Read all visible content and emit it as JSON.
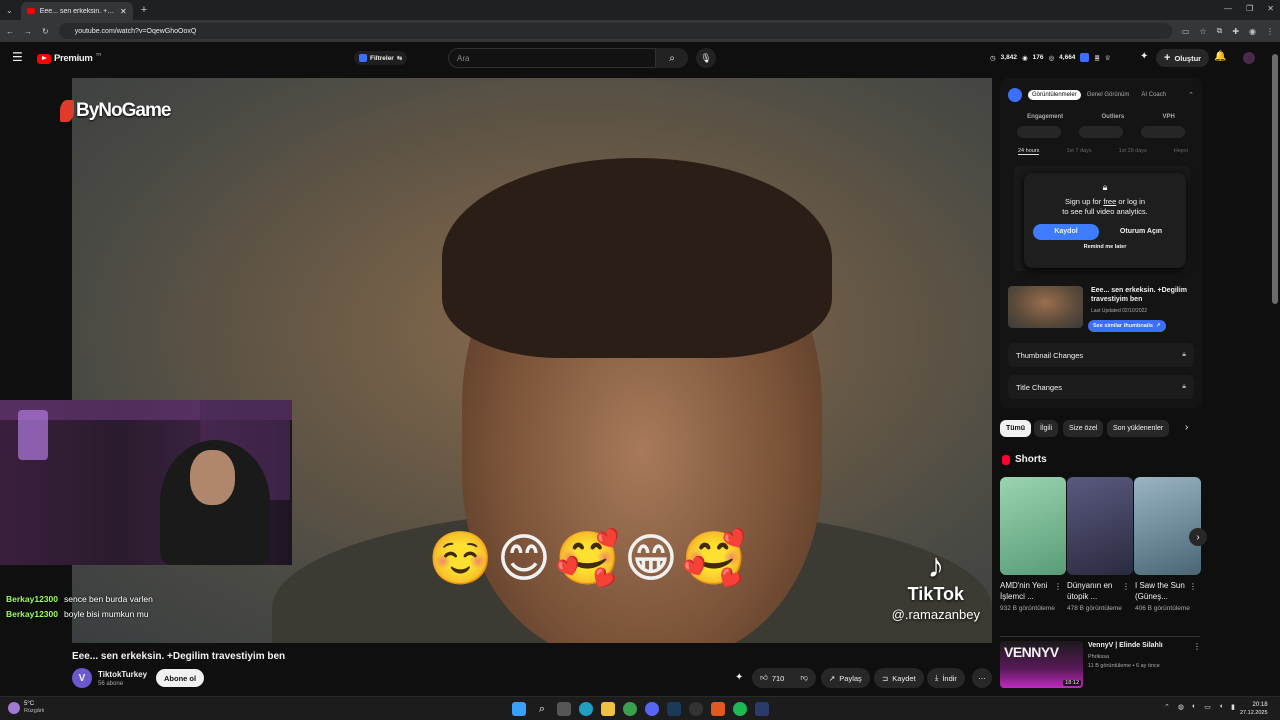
{
  "browser": {
    "tab_title": "Eee... sen erkeksin. +Degilim tr...",
    "url": "youtube.com/watch?v=OqewGhoOoxQ",
    "new_tab": "+"
  },
  "header": {
    "premium_label": "Premium",
    "premium_sup": "TR",
    "filters_label": "Filtreler",
    "search_placeholder": "Ara",
    "stat1": "3,842",
    "stat2": "176",
    "stat3": "4,664",
    "create_label": "Oluştur"
  },
  "video": {
    "watermark": "ByNoGame",
    "emojis": "☺️😊🥰😁🥰",
    "tiktok_brand": "TikTok",
    "tiktok_handle": "@.ramazanbey"
  },
  "chat": [
    {
      "user": "Berkay12300",
      "msg": "sence ben burda varlen"
    },
    {
      "user": "Berkay12300",
      "msg": "boyle bisi mumkun mu"
    }
  ],
  "below": {
    "title": "Eee... sen erkeksin. +Degilim travestiyim ben",
    "channel": "TiktokTurkey",
    "subs": "56 abone",
    "subscribe": "Abone ol",
    "likes": "710",
    "share": "Paylaş",
    "save": "Kaydet",
    "download": "İndir"
  },
  "analytics": {
    "tabs": [
      "Görüntülenmeler",
      "Genel Görünüm",
      "AI Coach"
    ],
    "metrics": [
      "Engagement",
      "Outliers",
      "VPH"
    ],
    "ranges": [
      "24 hours",
      "1st 7 days",
      "1st 28 days",
      "Hepsi"
    ],
    "popup_line1_a": "Sign up for ",
    "popup_free": "free",
    "popup_line1_b": " or log in",
    "popup_line2": "to see full video analytics.",
    "signup": "Kaydol",
    "login": "Oturum Açın",
    "remind": "Remind me later",
    "thumb_title": "Eee... sen erkeksin. +Degilim travestiyim ben",
    "last_updated": "Last Updated 02/10/2022",
    "similar": "See similar thumbnails",
    "thumb_changes": "Thumbnail Changes",
    "title_changes": "Title Changes"
  },
  "chips": [
    "Tümü",
    "İlgili",
    "Size özel",
    "Son yüklenenler"
  ],
  "shorts": {
    "heading": "Shorts",
    "items": [
      {
        "title": "AMD'nin Yeni İşlemci ...",
        "views": "932 B görüntüleme",
        "color": "#7ab88f"
      },
      {
        "title": "Dünyanın en ütopik ...",
        "views": "478 B görüntüleme",
        "color": "#4a4a66"
      },
      {
        "title": "I Saw the Sun (Güneş...",
        "views": "406 B görüntüleme",
        "color": "#6d8a99"
      }
    ]
  },
  "rec": {
    "title": "VennyV | Elinde Silahlı",
    "channel": "Phrikssa",
    "meta": "11 B görüntüleme • 6 ay önce",
    "duration": "18:12",
    "thumb_text": "VENNYV"
  },
  "taskbar": {
    "weather": "5°C",
    "weather_sub": "Rüzgârlı",
    "time": "20:18",
    "date": "27.12.2025"
  }
}
